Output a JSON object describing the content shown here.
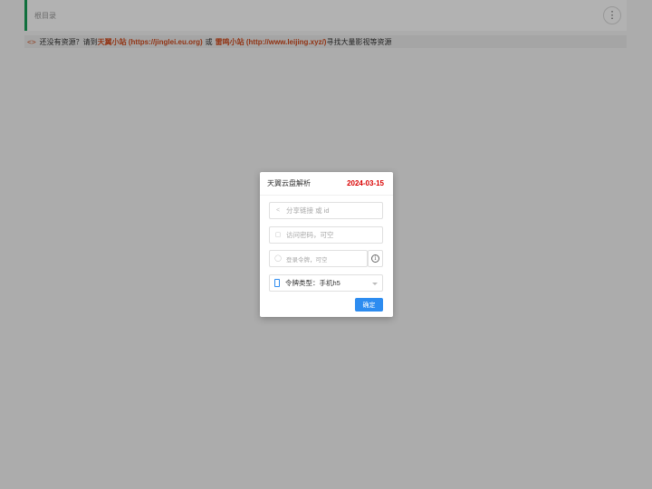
{
  "page": {
    "breadcrumb": "根目录",
    "more_icon": "⋮",
    "notice": {
      "icon": "<>",
      "prefix": "还没有资源？请到",
      "link1": "天翼小站 (https://jinglei.eu.org)",
      "middle": "或",
      "link2": "雷鸣小站 (http://www.leijing.xyz/)",
      "suffix": "寻找大量影视等资源"
    }
  },
  "dialog": {
    "title": "天翼云盘解析",
    "date": "2024-03-15",
    "share_input": {
      "placeholder": "分享链接 或 id",
      "icon": "share-icon"
    },
    "password_input": {
      "placeholder": "访问密码，可空",
      "icon": "lock-icon"
    },
    "token_input": {
      "placeholder": "登录令牌，可空",
      "icon": "clock-icon"
    },
    "info_icon": "i",
    "token_type_select": {
      "value": "令牌类型：手机h5",
      "icon": "phone-icon"
    },
    "confirm_label": "确定"
  },
  "colors": {
    "accent_bar": "#18a058",
    "link": "#d14b1e",
    "date": "#d90000",
    "primary_button": "#2d8cf0"
  }
}
